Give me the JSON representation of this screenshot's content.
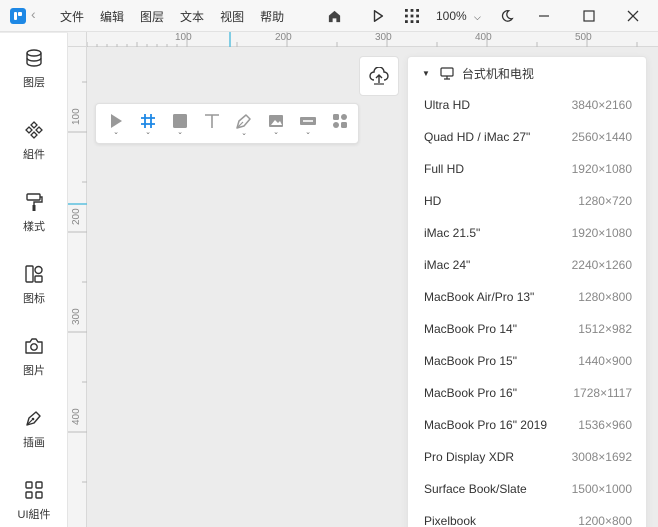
{
  "menu": {
    "items": [
      "文件",
      "编辑",
      "图层",
      "文本",
      "视图",
      "帮助"
    ]
  },
  "zoom": {
    "label": "100%"
  },
  "sidebar": {
    "items": [
      {
        "label": "图层",
        "icon": "layers-icon"
      },
      {
        "label": "組件",
        "icon": "components-icon"
      },
      {
        "label": "樣式",
        "icon": "paint-roller-icon"
      },
      {
        "label": "图标",
        "icon": "icons-icon"
      },
      {
        "label": "图片",
        "icon": "camera-icon"
      },
      {
        "label": "插画",
        "icon": "pen-nib-icon"
      },
      {
        "label": "UI組件",
        "icon": "grid-icon"
      }
    ]
  },
  "ruler": {
    "top": [
      "100",
      "200",
      "300",
      "400",
      "500"
    ],
    "left": [
      "100",
      "200",
      "300",
      "400"
    ]
  },
  "tools": [
    "move-tool",
    "frame-tool",
    "rectangle-tool",
    "text-tool",
    "pen-tool",
    "image-tool",
    "component-tool",
    "plugin-tool"
  ],
  "panel": {
    "title": "台式机和电视",
    "presets": [
      {
        "name": "Ultra HD",
        "size": "3840×2160"
      },
      {
        "name": "Quad HD / iMac 27\"",
        "size": "2560×1440"
      },
      {
        "name": "Full HD",
        "size": "1920×1080"
      },
      {
        "name": "HD",
        "size": "1280×720"
      },
      {
        "name": "iMac 21.5\"",
        "size": "1920×1080"
      },
      {
        "name": "iMac 24\"",
        "size": "2240×1260"
      },
      {
        "name": "MacBook Air/Pro 13\"",
        "size": "1280×800"
      },
      {
        "name": "MacBook Pro 14\"",
        "size": "1512×982"
      },
      {
        "name": "MacBook Pro 15\"",
        "size": "1440×900"
      },
      {
        "name": "MacBook Pro 16\"",
        "size": "1728×1117"
      },
      {
        "name": "MacBook Pro 16\" 2019",
        "size": "1536×960"
      },
      {
        "name": "Pro Display XDR",
        "size": "3008×1692"
      },
      {
        "name": "Surface Book/Slate",
        "size": "1500×1000"
      },
      {
        "name": "Pixelbook",
        "size": "1200×800"
      }
    ]
  },
  "colors": {
    "accent": "#1e88e5",
    "ruler_marker": "#5bc0de"
  }
}
